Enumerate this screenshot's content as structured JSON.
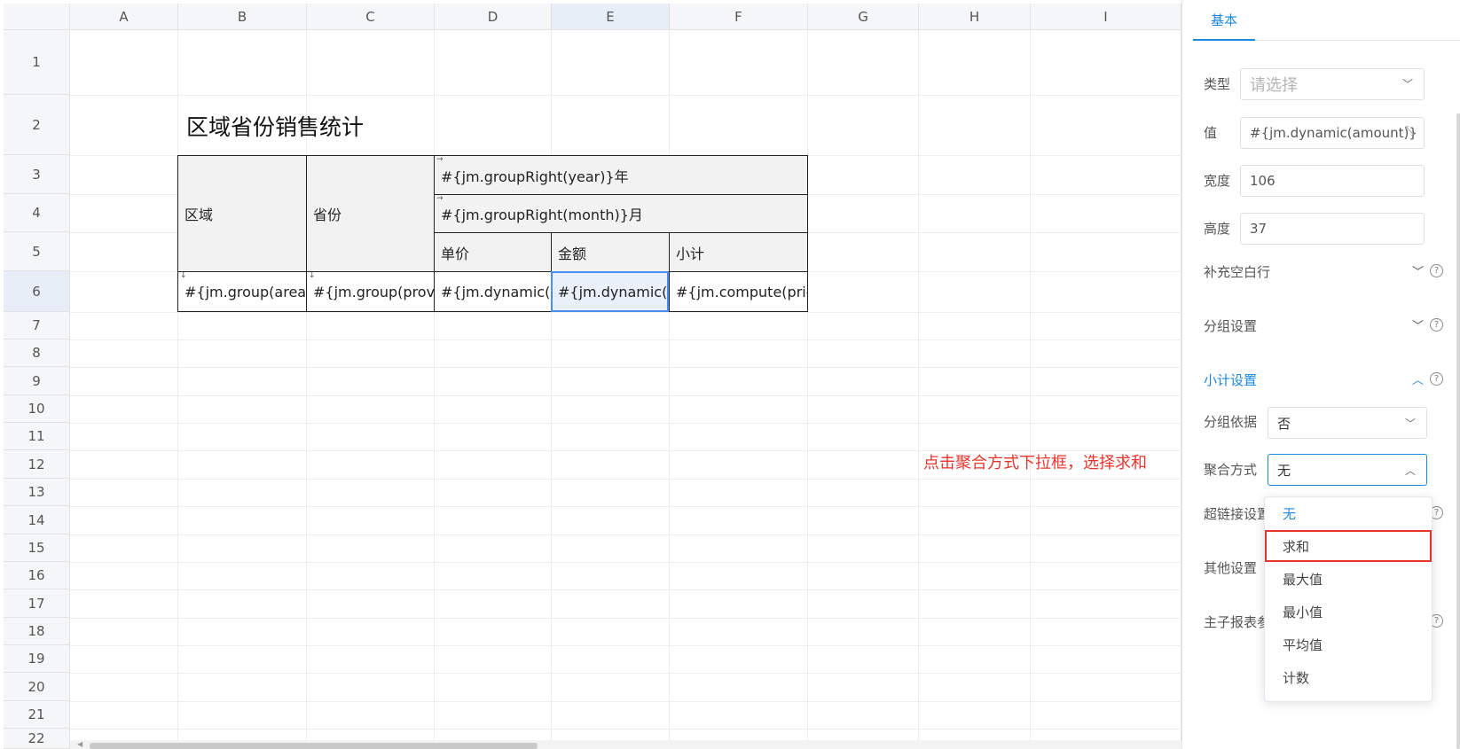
{
  "columns": [
    "A",
    "B",
    "C",
    "D",
    "E",
    "F",
    "G",
    "H",
    "I"
  ],
  "rows": [
    "1",
    "2",
    "3",
    "4",
    "5",
    "6",
    "7",
    "8",
    "9",
    "10",
    "11",
    "12",
    "13",
    "14",
    "15",
    "16",
    "17",
    "18",
    "19",
    "20",
    "21",
    "22"
  ],
  "report": {
    "title": "区域省份销售统计",
    "region": "区域",
    "province": "省份",
    "year_group": "#{jm.groupRight(year)}年",
    "month_group": "#{jm.groupRight(month)}月",
    "unit_price": "单价",
    "amount": "金额",
    "subtotal": "小计",
    "group_area": "#{jm.group(area",
    "group_province": "#{jm.group(provi",
    "dynamic_price": "#{jm.dynamic(p",
    "dynamic_amount": "#{jm.dynamic(a",
    "compute_price": "#{jm.compute(pric"
  },
  "hint": "点击聚合方式下拉框，选择求和",
  "panel": {
    "tab": "基本",
    "type_label": "类型",
    "type_placeholder": "请选择",
    "value_label": "值",
    "value": "#{jm.dynamic(amount)}",
    "width_label": "宽度",
    "width": "106",
    "height_label": "高度",
    "height": "37",
    "fill_blank_rows": "补充空白行",
    "group_settings": "分组设置",
    "subtotal_settings": "小计设置",
    "group_basis_label": "分组依据",
    "group_basis_value": "否",
    "aggregate_label": "聚合方式",
    "aggregate_value": "无",
    "hyperlink_settings": "超链接设置",
    "other_settings": "其他设置",
    "master_sub_params": "主子报表参"
  },
  "dropdown_options": [
    "无",
    "求和",
    "最大值",
    "最小值",
    "平均值",
    "计数"
  ],
  "accent_color": "#1e88e5",
  "annotation_color": "#e8342e"
}
